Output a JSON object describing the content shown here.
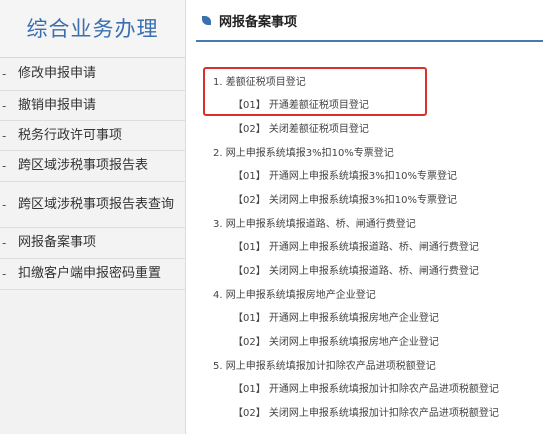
{
  "sidebar": {
    "title": "综合业务办理",
    "items": [
      {
        "label": "修改申报申请"
      },
      {
        "label": "撤销申报申请"
      },
      {
        "label": "税务行政许可事项"
      },
      {
        "label": "跨区域涉税事项报告表"
      },
      {
        "label": "跨区域涉税事项报告表查询"
      },
      {
        "label": "网报备案事项"
      },
      {
        "label": "扣缴客户端申报密码重置"
      }
    ]
  },
  "main": {
    "title": "网报备案事项",
    "sections": [
      {
        "heading": "1. 差额征税项目登记",
        "items": [
          "【01】 开通差额征税项目登记",
          "【02】 关闭差额征税项目登记"
        ]
      },
      {
        "heading": "2. 网上申报系统填报3%扣10%专票登记",
        "items": [
          "【01】  开通网上申报系统填报3%扣10%专票登记",
          "【02】  关闭网上申报系统填报3%扣10%专票登记"
        ]
      },
      {
        "heading": "3. 网上申报系统填报道路、桥、闸通行费登记",
        "items": [
          "【01】  开通网上申报系统填报道路、桥、闸通行费登记",
          "【02】  关闭网上申报系统填报道路、桥、闸通行费登记"
        ]
      },
      {
        "heading": "4. 网上申报系统填报房地产企业登记",
        "items": [
          "【01】  开通网上申报系统填报房地产企业登记",
          "【02】  关闭网上申报系统填报房地产企业登记"
        ]
      },
      {
        "heading": "5. 网上申报系统填报加计扣除农产品进项税额登记",
        "items": [
          "【01】  开通网上申报系统填报加计扣除农产品进项税额登记",
          "【02】  关闭网上申报系统填报加计扣除农产品进项税额登记"
        ]
      }
    ]
  },
  "colors": {
    "accent": "#3a6fb0",
    "highlight": "#d9302c"
  },
  "icons": {
    "header": "leaf-icon"
  }
}
